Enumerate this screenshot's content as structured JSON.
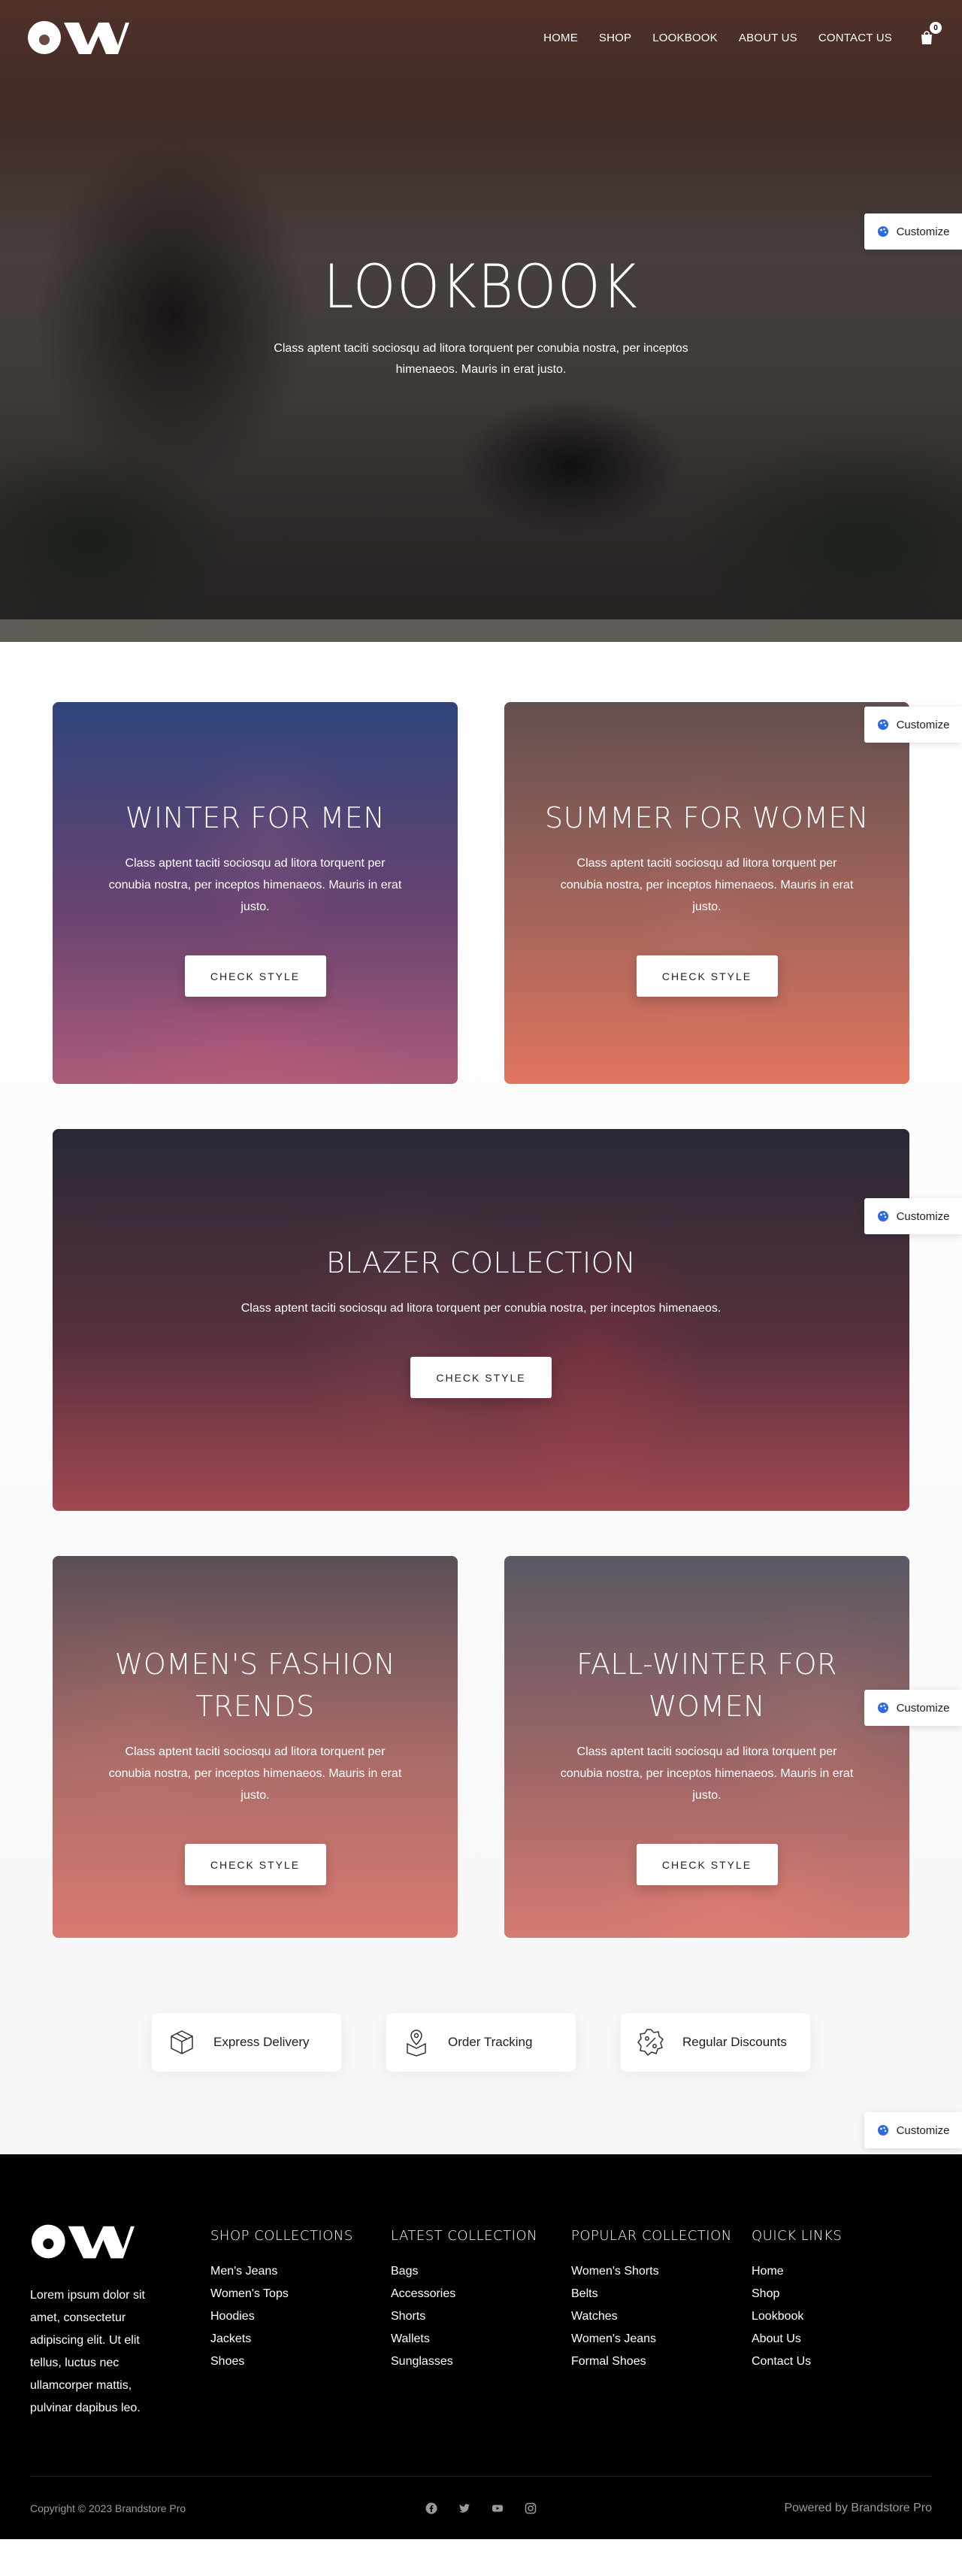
{
  "header": {
    "logo_alt": "OW",
    "nav": [
      {
        "label": "HOME"
      },
      {
        "label": "SHOP"
      },
      {
        "label": "LOOKBOOK"
      },
      {
        "label": "ABOUT US"
      },
      {
        "label": "CONTACT US"
      }
    ],
    "cart_count": "0",
    "cart_icon": "shopping-bag-icon"
  },
  "hero": {
    "title": "LOOKBOOK",
    "text": "Class aptent taciti sociosqu ad litora torquent per conubia nostra, per inceptos himenaeos. Mauris in erat justo."
  },
  "customize_label": "Customize",
  "cards": [
    {
      "title": "WINTER FOR MEN",
      "text": "Class aptent taciti sociosqu ad litora torquent per conubia nostra, per inceptos himenaeos. Mauris in erat justo.",
      "button": "CHECK STYLE"
    },
    {
      "title": "SUMMER FOR WOMEN",
      "text": "Class aptent taciti sociosqu ad litora torquent per conubia nostra, per inceptos himenaeos. Mauris in erat justo.",
      "button": "CHECK STYLE"
    },
    {
      "title": "BLAZER COLLECTION",
      "text": "Class aptent taciti sociosqu ad litora torquent per conubia nostra, per inceptos himenaeos.",
      "button": "CHECK STYLE"
    },
    {
      "title": "WOMEN'S FASHION TRENDS",
      "text": "Class aptent taciti sociosqu ad litora torquent per conubia nostra, per inceptos himenaeos. Mauris in erat justo.",
      "button": "CHECK STYLE"
    },
    {
      "title": "FALL-WINTER FOR WOMEN",
      "text": "Class aptent taciti sociosqu ad litora torquent per conubia nostra, per inceptos himenaeos. Mauris in erat justo.",
      "button": "CHECK STYLE"
    }
  ],
  "features": [
    {
      "label": "Express Delivery",
      "icon": "package-box-icon"
    },
    {
      "label": "Order Tracking",
      "icon": "location-box-icon"
    },
    {
      "label": "Regular Discounts",
      "icon": "discount-badge-icon"
    }
  ],
  "footer": {
    "about": "Lorem ipsum dolor sit amet, consectetur adipiscing elit. Ut elit tellus, luctus nec ullamcorper mattis, pulvinar dapibus leo.",
    "columns": [
      {
        "title": "SHOP COLLECTIONS",
        "links": [
          "Men's Jeans",
          "Women's Tops",
          "Hoodies",
          "Jackets",
          "Shoes"
        ]
      },
      {
        "title": "LATEST COLLECTION",
        "links": [
          "Bags",
          "Accessories",
          "Shorts",
          "Wallets",
          "Sunglasses"
        ]
      },
      {
        "title": "POPULAR COLLECTION",
        "links": [
          "Women's Shorts",
          "Belts",
          "Watches",
          "Women's Jeans",
          "Formal Shoes"
        ]
      },
      {
        "title": "QUICK LINKS",
        "links": [
          "Home",
          "Shop",
          "Lookbook",
          "About Us",
          "Contact Us"
        ]
      }
    ],
    "copyright": "Copyright © 2023 Brandstore Pro",
    "powered": "Powered by Brandstore Pro",
    "socials": [
      "facebook-icon",
      "twitter-icon",
      "youtube-icon",
      "instagram-icon"
    ]
  },
  "colors": {
    "footer_bg": "#000000",
    "page_bg": "#f7f7f7",
    "customize_accent": "#2f6be0"
  }
}
